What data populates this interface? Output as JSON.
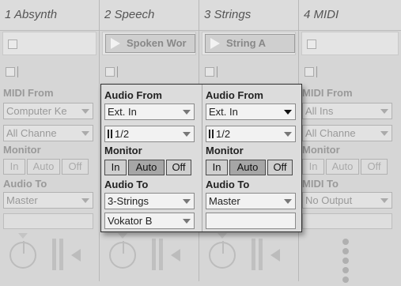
{
  "tracks": [
    {
      "title": "1 Absynth",
      "routing_from_label": "MIDI From",
      "from_value": "Computer Ke",
      "channel_value": "All Channe",
      "monitor_label": "Monitor",
      "monitor": [
        "In",
        "Auto",
        "Off"
      ],
      "to_label": "Audio To",
      "to_value": "Master"
    },
    {
      "title": "2 Speech",
      "clip": "Spoken Wor"
    },
    {
      "title": "3 Strings",
      "clip": "String A"
    },
    {
      "title": "4 MIDI",
      "routing_from_label": "MIDI From",
      "from_value": "All Ins",
      "channel_value": "All Channe",
      "monitor_label": "Monitor",
      "monitor": [
        "In",
        "Auto",
        "Off"
      ],
      "to_label": "MIDI To",
      "to_value": "No Output"
    }
  ],
  "popup": {
    "col1": {
      "from_label": "Audio From",
      "from_value": "Ext. In",
      "input_value": "1/2",
      "monitor_label": "Monitor",
      "monitor": [
        "In",
        "Auto",
        "Off"
      ],
      "monitor_active": "Auto",
      "to_label": "Audio To",
      "to_value": "3-Strings",
      "sub_value": "Vokator B"
    },
    "col2": {
      "from_label": "Audio From",
      "from_value": "Ext. In",
      "input_value": "1/2",
      "monitor_label": "Monitor",
      "monitor": [
        "In",
        "Auto",
        "Off"
      ],
      "monitor_active": "Auto",
      "to_label": "Audio To",
      "to_value": "Master",
      "sub_value": ""
    }
  },
  "colors": {
    "accent": "#a6a6a6",
    "background": "#d6d6d6",
    "popup_border": "#2e2e2e"
  },
  "icons": [
    "stop-square-icon",
    "play-triangle-icon",
    "dropdown-arrow-icon",
    "pan-knob-icon",
    "meter-icon",
    "speaker-icon",
    "drag-dots-icon"
  ]
}
